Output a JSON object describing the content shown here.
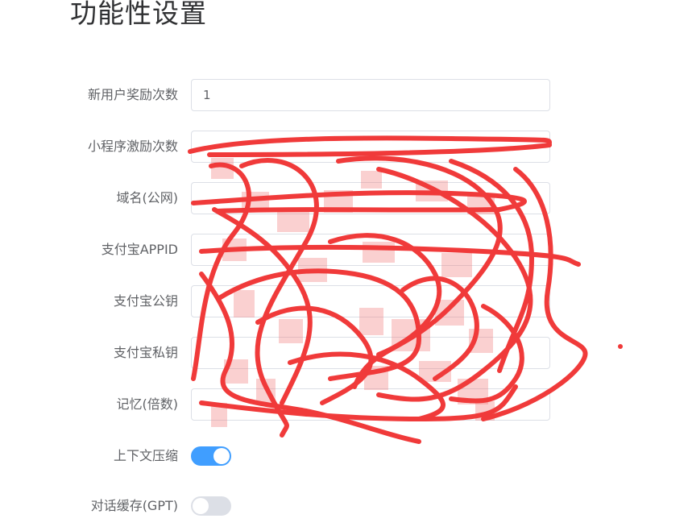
{
  "page": {
    "title": "功能性设置"
  },
  "form": {
    "fields": [
      {
        "label": "新用户奖励次数",
        "value": "1"
      },
      {
        "label": "小程序激励次数",
        "value": ""
      },
      {
        "label": "域名(公网)",
        "value": ""
      },
      {
        "label": "支付宝APPID",
        "value": ""
      },
      {
        "label": "支付宝公钥",
        "value": ""
      },
      {
        "label": "支付宝私钥",
        "value": ""
      },
      {
        "label": "记忆(倍数)",
        "value": ""
      }
    ],
    "switches": [
      {
        "label": "上下文压缩",
        "state": "on"
      },
      {
        "label": "对话缓存(GPT)",
        "state": "off"
      }
    ]
  },
  "colors": {
    "switch_on": "#409eff",
    "switch_off": "#dcdfe6",
    "redaction": "#f03333"
  }
}
